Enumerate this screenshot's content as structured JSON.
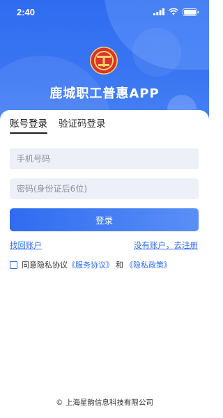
{
  "status_bar": {
    "time": "2:40",
    "icons": [
      "signal-icon",
      "wifi-icon",
      "battery-icon"
    ]
  },
  "header": {
    "app_title": "鹿城职工普惠APP",
    "logo": "union-logo"
  },
  "tabs": [
    {
      "label": "账号登录",
      "active": true
    },
    {
      "label": "验证码登录",
      "active": false
    }
  ],
  "form": {
    "phone_placeholder": "手机号码",
    "password_placeholder": "密码(身份证后6位)",
    "login_label": "登录",
    "forgot_label": "找回账户",
    "register_label": "没有账户，去注册"
  },
  "agreement": {
    "prefix": "同意隐私协议",
    "service": "《服务协议》",
    "conjunction": "和",
    "privacy": "《隐私政策》"
  },
  "footer": {
    "copyright": "© 上海星韵信息科技有限公司"
  },
  "colors": {
    "primary": "#2f6cf0",
    "input_bg": "#eef0f8"
  }
}
